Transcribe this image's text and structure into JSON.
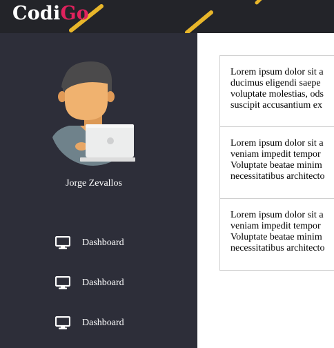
{
  "header": {
    "logo_part1": "Codi",
    "logo_part2": "Go",
    "colors": {
      "background": "#232429",
      "logo_accent": "#e0225d",
      "streak": "#e8b62a"
    }
  },
  "sidebar": {
    "username": "Jorge Zevallos",
    "items": [
      {
        "icon": "monitor-icon",
        "label": "Dashboard"
      },
      {
        "icon": "monitor-icon",
        "label": "Dashboard"
      },
      {
        "icon": "monitor-icon",
        "label": "Dashboard"
      }
    ],
    "colors": {
      "background": "#2d2e39"
    }
  },
  "cards": [
    {
      "lines": [
        "Lorem ipsum dolor sit a",
        "ducimus eligendi saepe",
        "voluptate molestias, ods",
        "suscipit accusantium ex"
      ]
    },
    {
      "lines": [
        "Lorem ipsum dolor sit a",
        "veniam impedit tempor",
        "Voluptate beatae minim",
        "necessitatibus architecto"
      ]
    },
    {
      "lines": [
        "Lorem ipsum dolor sit a",
        "veniam impedit tempor",
        "Voluptate beatae minim",
        "necessitatibus architecto"
      ]
    }
  ]
}
